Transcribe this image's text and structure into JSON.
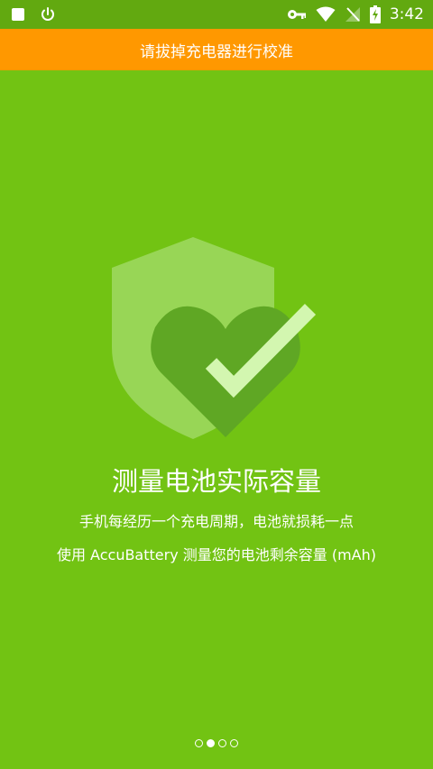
{
  "status_bar": {
    "time": "3:42",
    "icons_left": [
      "stop-icon",
      "power-icon"
    ],
    "icons_right": [
      "key-icon",
      "wifi-icon",
      "no-signal-icon",
      "battery-charging-icon"
    ]
  },
  "banner": {
    "text": "请拔掉充电器进行校准",
    "color": "#ff9800"
  },
  "content": {
    "title": "测量电池实际容量",
    "line1": "手机每经历一个充电周期，电池就损耗一点",
    "line2": "使用 AccuBattery 测量您的电池剩余容量 (mAh)"
  },
  "pager": {
    "count": 4,
    "active_index": 1
  },
  "colors": {
    "background": "#72c313",
    "status_bar": "#62a910",
    "shield": "#98d656",
    "heart": "#5fa724",
    "check": "#d3f6b0"
  }
}
